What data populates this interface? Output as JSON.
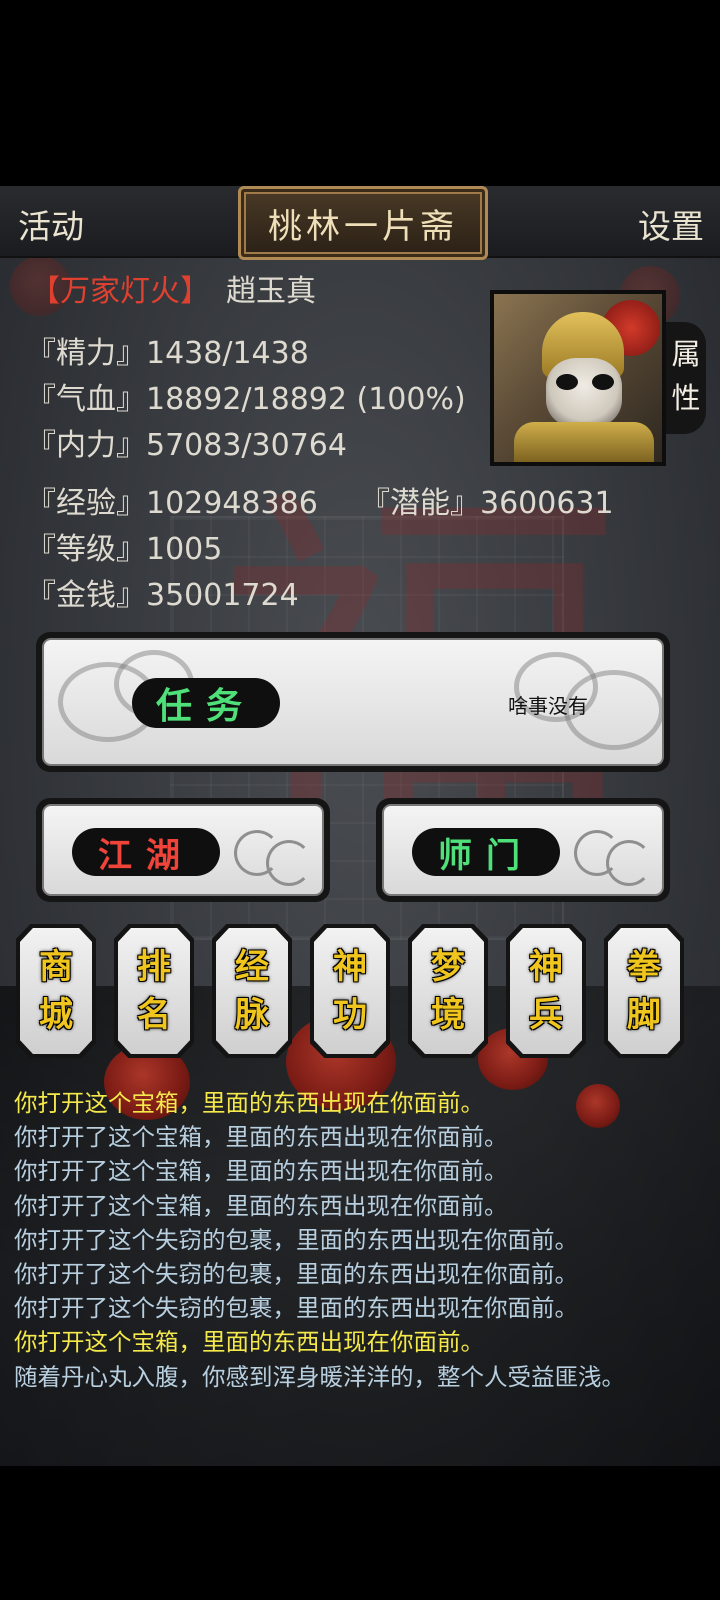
{
  "header": {
    "left_label": "活动",
    "title": "桃林一片斋",
    "right_label": "设置"
  },
  "character": {
    "guild": "【万家灯火】",
    "name": "趙玉真",
    "stats": [
      {
        "label": "『精力』",
        "value": "1438/1438"
      },
      {
        "label": "『气血』",
        "value": "18892/18892 (100%)"
      },
      {
        "label": "『内力』",
        "value": "57083/30764"
      },
      {
        "label": "『经验』",
        "value": "102948386"
      },
      {
        "label": "『潜能』",
        "value": "3600631"
      },
      {
        "label": "『等级』",
        "value": "1005"
      },
      {
        "label": "『金钱』",
        "value": "35001724"
      }
    ],
    "attr_tab": [
      "属",
      "性"
    ]
  },
  "buttons": {
    "task_label": "任务",
    "task_status": "啥事没有",
    "jianghu_label": "江湖",
    "shimen_label": "师门"
  },
  "menu": [
    {
      "line1": "商",
      "line2": "城"
    },
    {
      "line1": "排",
      "line2": "名"
    },
    {
      "line1": "经",
      "line2": "脉"
    },
    {
      "line1": "神",
      "line2": "功"
    },
    {
      "line1": "梦",
      "line2": "境"
    },
    {
      "line1": "神",
      "line2": "兵"
    },
    {
      "line1": "拳",
      "line2": "脚"
    }
  ],
  "log": [
    {
      "text": "你打开这个宝箱，里面的东西出现在你面前。",
      "style": "hl"
    },
    {
      "text": "你打开了这个宝箱，里面的东西出现在你面前。",
      "style": "nm"
    },
    {
      "text": "你打开了这个宝箱，里面的东西出现在你面前。",
      "style": "nm"
    },
    {
      "text": "你打开了这个宝箱，里面的东西出现在你面前。",
      "style": "nm"
    },
    {
      "text": "你打开了这个失窃的包裹，里面的东西出现在你面前。",
      "style": "nm"
    },
    {
      "text": "你打开了这个失窃的包裹，里面的东西出现在你面前。",
      "style": "nm"
    },
    {
      "text": "你打开了这个失窃的包裹，里面的东西出现在你面前。",
      "style": "nm"
    },
    {
      "text": "你打开这个宝箱，里面的东西出现在你面前。",
      "style": "hl"
    },
    {
      "text": "随着丹心丸入腹，你感到浑身暖洋洋的，整个人受益匪浅。",
      "style": "nm"
    }
  ],
  "colors": {
    "highlight_log": "#f4e84a",
    "normal_log": "#b8cfe0",
    "guild": "#e0402f",
    "task_text": "#4fe07a",
    "jianghu_text": "#f0443a",
    "menu_text": "#f0c61e"
  }
}
